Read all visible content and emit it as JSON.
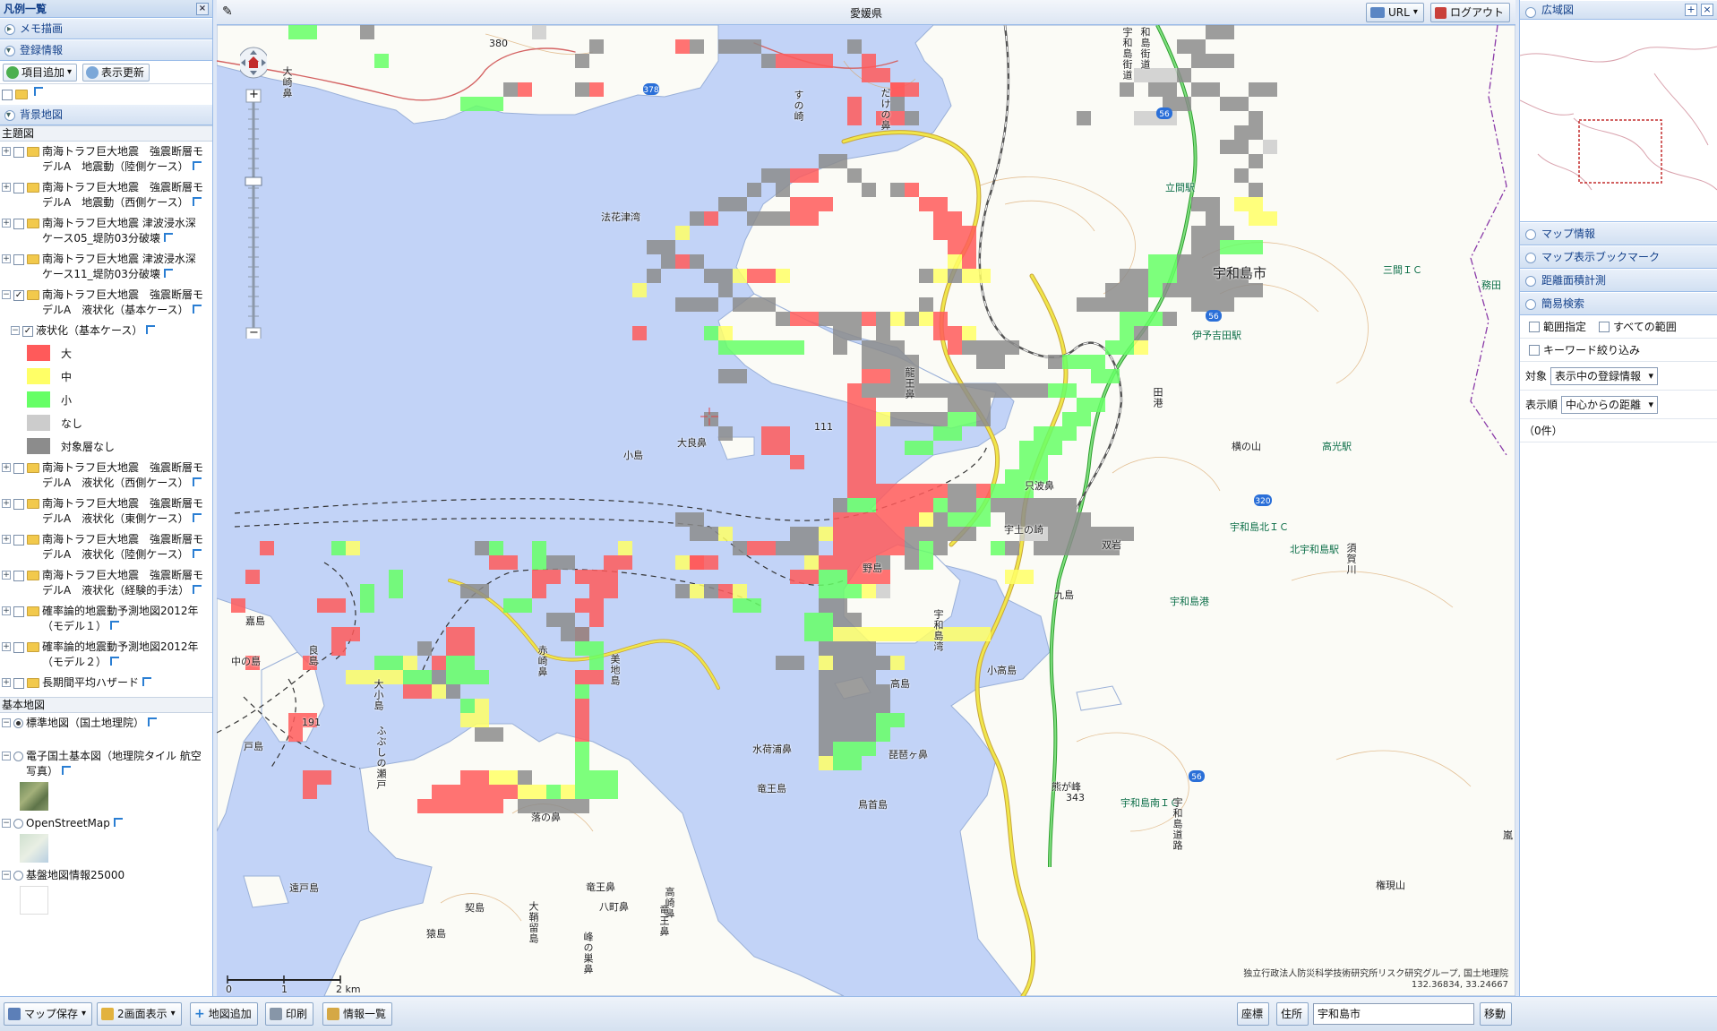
{
  "left_panel": {
    "title": "凡例一覧",
    "close_label": "×",
    "sections": {
      "memo": "メモ描画",
      "registered": "登録情報",
      "background": "背景地図"
    },
    "add_item_label": "項目追加",
    "refresh_label": "表示更新",
    "theme_header": "主題図",
    "theme_layers": [
      {
        "line1": "南海トラフ巨大地震　強震断層モ",
        "line2": "デルA　地震動（陸側ケース）",
        "checked": false,
        "expand": "+"
      },
      {
        "line1": "南海トラフ巨大地震　強震断層モ",
        "line2": "デルA　地震動（西側ケース）",
        "checked": false,
        "expand": "+"
      },
      {
        "line1": "南海トラフ巨大地震 津波浸水深",
        "line2": "ケース05_堤防03分破壊",
        "checked": false,
        "expand": "+"
      },
      {
        "line1": "南海トラフ巨大地震 津波浸水深",
        "line2": "ケース11_堤防03分破壊",
        "checked": false,
        "expand": "+"
      },
      {
        "line1": "南海トラフ巨大地震　強震断層モ",
        "line2": "デルA　液状化（基本ケース）",
        "checked": true,
        "expand": "−"
      }
    ],
    "sublayer": {
      "label": "液状化（基本ケース）",
      "checked": "✓"
    },
    "legend": [
      {
        "label": "大",
        "color": "#ff5a5a"
      },
      {
        "label": "中",
        "color": "#ffff66"
      },
      {
        "label": "小",
        "color": "#66ff66"
      },
      {
        "label": "なし",
        "color": "#cccccc"
      },
      {
        "label": "対象層なし",
        "color": "#8c8c8c"
      }
    ],
    "more_layers": [
      {
        "line1": "南海トラフ巨大地震　強震断層モ",
        "line2": "デルA　液状化（西側ケース）"
      },
      {
        "line1": "南海トラフ巨大地震　強震断層モ",
        "line2": "デルA　液状化（東側ケース）"
      },
      {
        "line1": "南海トラフ巨大地震　強震断層モ",
        "line2": "デルA　液状化（陸側ケース）"
      },
      {
        "line1": "南海トラフ巨大地震　強震断層モ",
        "line2": "デルA　液状化（経験的手法）"
      },
      {
        "line1": "確率論的地震動予測地図2012年",
        "line2": "（モデル１）"
      },
      {
        "line1": "確率論的地震動予測地図2012年",
        "line2": "（モデル２）"
      },
      {
        "line1": "長期間平均ハザード",
        "line2": ""
      }
    ],
    "base_header": "基本地図",
    "base_maps": [
      {
        "label": "標準地図（国土地理院）",
        "selected": true
      },
      {
        "label": "電子国土基本図（地理院タイル 航空写真）",
        "selected": false
      },
      {
        "label": "OpenStreetMap",
        "selected": false
      },
      {
        "label": "基盤地図情報25000",
        "selected": false
      }
    ],
    "expand_plus": "+",
    "checkmark": "✓"
  },
  "map": {
    "title": "愛媛県",
    "url_label": "URL",
    "logout_label": "ログアウト",
    "zoom_in": "+",
    "zoom_out": "−",
    "scale_labels": [
      "0",
      "1",
      "2 km"
    ],
    "attribution_line1": "独立行政法人防災科学技術研究所リスク研究グループ, 国土地理院",
    "attribution_line2": "132.36834, 33.24667",
    "labels": {
      "city": "宇和島市",
      "stations": [
        "立間駅",
        "伊予吉田駅",
        "高光駅",
        "北宇和島駅",
        "宇和島港",
        "務田"
      ],
      "ic": [
        "三間ＩＣ",
        "宇和島北ＩＣ",
        "宇和島南ＩＣ"
      ],
      "places": [
        "法花津湾",
        "小島",
        "大良鼻",
        "只波鼻",
        "宇土の崎",
        "野島",
        "嘉島",
        "中の島",
        "九島",
        "小高島",
        "高島",
        "戸島",
        "遠戸島",
        "契島",
        "猿島",
        "竜王島",
        "八町鼻",
        "竜王鼻",
        "鳥首島",
        "熊が峰",
        "琵琶ヶ鼻",
        "水荷浦鼻",
        "落の鼻",
        "権現山",
        "横の山",
        "双岩",
        "嵐",
        "須賀川",
        "宇和島湾",
        "赤崎鼻",
        "美地島",
        "高崎鼻",
        "大小島",
        "良島",
        "すの崎",
        "だけの鼻",
        "龍王鼻",
        "大崎鼻",
        "大鞘留島",
        "峰の巣鼻",
        "竜王鼻",
        "ふぶしの瀬戸",
        "宇和島街道",
        "宇和島道路",
        "和島街道",
        "田港"
      ],
      "elevations": [
        "380",
        "111",
        "191",
        "343"
      ],
      "route_numbers": [
        "378",
        "56",
        "320"
      ]
    }
  },
  "right_panel": {
    "overview_title": "広域図",
    "overview_plus": "+",
    "overview_close": "×",
    "sections": [
      "マップ情報",
      "マップ表示ブックマーク",
      "距離面積計測",
      "簡易検索"
    ],
    "search": {
      "range_label": "範囲指定",
      "all_range_label": "すべての範囲",
      "keyword_label": "キーワード絞り込み",
      "target_label": "対象",
      "target_value": "表示中の登録情報",
      "order_label": "表示順",
      "order_value": "中心からの距離",
      "count_text": "（0件）"
    }
  },
  "bottom_bar": {
    "save_map": "マップ保存",
    "two_screen": "2画面表示",
    "add_map": "地図追加",
    "print": "印刷",
    "info_list": "情報一覧",
    "coord_label": "座標",
    "address_label": "住所",
    "address_value": "宇和島市",
    "move_label": "移動"
  },
  "colors": {
    "sea": "#c2d3f7",
    "land": "#fbfbf6",
    "liq_high": "#ff5a5a",
    "liq_mid": "#ffff66",
    "liq_low": "#66ff66",
    "liq_none": "#cccccc",
    "liq_na": "#8c8c8c",
    "road_main": "#f0e64a",
    "expressway": "#40c040",
    "rail": "#555555",
    "contour": "#d9a56a"
  }
}
